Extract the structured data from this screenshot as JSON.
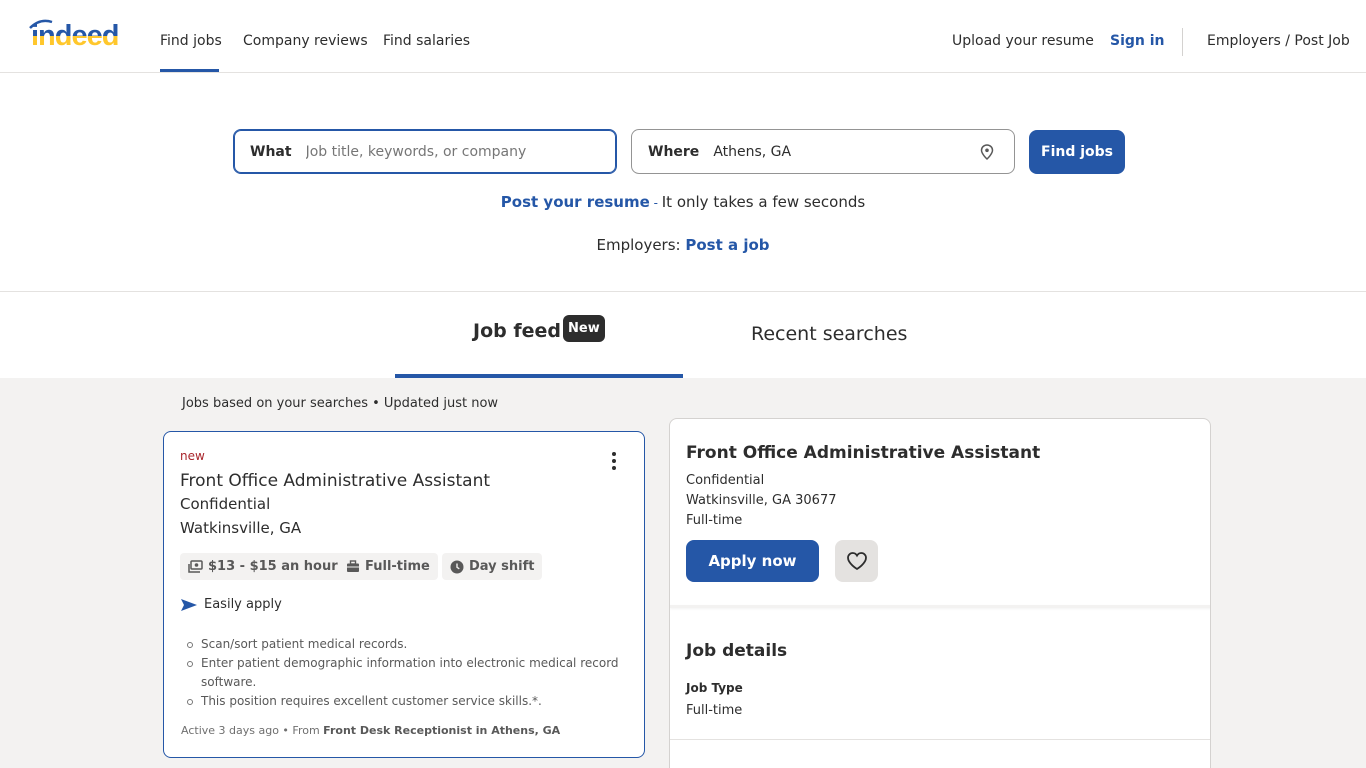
{
  "header": {
    "logo_text": "indeed",
    "nav": [
      "Find jobs",
      "Company reviews",
      "Find salaries"
    ],
    "upload_resume": "Upload your resume",
    "sign_in": "Sign in",
    "employers": "Employers / Post Job"
  },
  "search": {
    "what_label": "What",
    "what_placeholder": "Job title, keywords, or company",
    "where_label": "Where",
    "where_value": "Athens, GA",
    "find_button": "Find jobs"
  },
  "promo": {
    "post_resume_link": "Post your resume",
    "post_resume_dash": " - ",
    "post_resume_text": "It only takes a few seconds",
    "employers_prefix": "Employers: ",
    "post_job_link": "Post a job"
  },
  "tabs": {
    "job_feed": "Job feed",
    "new_badge": "New",
    "recent_searches": "Recent searches"
  },
  "feed": {
    "info": "Jobs based on your searches • Updated just now"
  },
  "job_card": {
    "new_label": "new",
    "title": "Front Office Administrative Assistant",
    "company": "Confidential",
    "location": "Watkinsville, GA",
    "chips": {
      "salary": "$13 - $15 an hour",
      "job_type": "Full-time",
      "shift": "Day shift"
    },
    "easily_apply": "Easily apply",
    "bullets": [
      "Scan/sort patient medical records.",
      "Enter patient demographic information into electronic medical record software.",
      "This position requires excellent customer service skills.*."
    ],
    "footer_prefix": "Active 3 days ago • From ",
    "footer_source": "Front Desk Receptionist in Athens, GA"
  },
  "detail": {
    "title": "Front Office Administrative Assistant",
    "company": "Confidential",
    "location": "Watkinsville, GA 30677",
    "job_type": "Full-time",
    "apply_button": "Apply now",
    "details_heading": "Job details",
    "job_type_label": "Job Type",
    "job_type_value": "Full-time"
  },
  "colors": {
    "brand_blue": "#2557a7",
    "logo_yellow": "#ffc72c",
    "new_red": "#a9252b"
  }
}
